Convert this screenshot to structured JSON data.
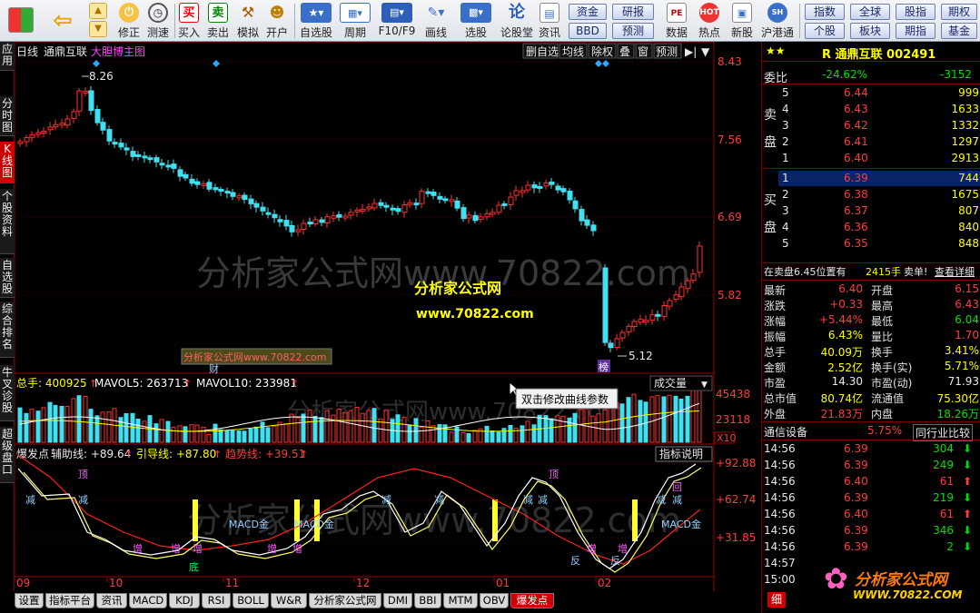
{
  "toolbar": {
    "buttons": [
      {
        "label": "修正"
      },
      {
        "label": "测速"
      },
      {
        "label": "买入"
      },
      {
        "label": "卖出"
      },
      {
        "label": "模拟"
      },
      {
        "label": "开户"
      },
      {
        "label": "自选股"
      },
      {
        "label": "周期"
      },
      {
        "label": "F10/F9"
      },
      {
        "label": "画线"
      },
      {
        "label": "选股"
      },
      {
        "label": "论股堂"
      },
      {
        "label": "资讯"
      },
      {
        "label": "数据"
      },
      {
        "label": "热点"
      },
      {
        "label": "新股"
      },
      {
        "label": "沪港通"
      }
    ],
    "buy_glyph": "买",
    "sell_glyph": "卖",
    "lun_glyph": "论",
    "nav_buttons": [
      "资金",
      "研报",
      "BBD",
      "预测",
      "指数",
      "全球",
      "股指",
      "期权",
      "个股",
      "板块",
      "期指",
      "基金"
    ]
  },
  "left_tabs": [
    "应用",
    "分时图",
    "K线图",
    "个股资料",
    "自选股",
    "综合排名",
    "牛叉诊股",
    "超级盘口"
  ],
  "main_chart": {
    "period": "日线",
    "stock_name": "通鼎互联",
    "indicator": "大胆博主图",
    "right_buttons": [
      "删自选",
      "均线",
      "除权",
      "叠",
      "窗",
      "预测"
    ],
    "price_ticks": [
      "8.43",
      "7.56",
      "6.69",
      "5.82"
    ],
    "high_label": "8.26",
    "low_label": "5.12",
    "watermark": "分析家公式网www.70822.com",
    "site_name": "分析家公式网",
    "site_url": "www.70822.com",
    "site_box": "分析家公式网www.70822.com",
    "cai_label": "财",
    "bang_label": "榜"
  },
  "volume_panel": {
    "total_label": "总手: 400925",
    "ma5_label": "MAVOL5: 263713",
    "ma10_label": "MAVOL10: 233981",
    "selector": "成交量",
    "ticks": [
      "45438",
      "23118",
      "X10"
    ],
    "tooltip": "双击修改曲线参数"
  },
  "indicator_panel": {
    "name": "爆发点",
    "aux_label": "辅助线: +89.64",
    "guide_label": "引导线: +87.80",
    "trend_label": "趋势线: +39.51",
    "help_button": "指标说明",
    "ticks": [
      "+92.88",
      "+62.74",
      "+31.85"
    ],
    "marks": [
      "顶",
      "减",
      "减",
      "增",
      "增",
      "增",
      "底",
      "MACD金",
      "MACD金",
      "增",
      "增",
      "减",
      "减",
      "减",
      "顶",
      "反",
      "增",
      "增",
      "反",
      "减",
      "减",
      "回",
      "MACD金",
      "减"
    ]
  },
  "time_axis": [
    "09",
    "10",
    "11",
    "12",
    "01",
    "02"
  ],
  "bottom_tabs": [
    "设置",
    "指标平台",
    "资讯",
    "MACD",
    "KDJ",
    "RSI",
    "BOLL",
    "W&R",
    "分析家公式网",
    "DMI",
    "BBI",
    "MTM",
    "OBV",
    "爆发点"
  ],
  "quote": {
    "stars": "★★",
    "title": "R 通鼎互联 002491",
    "weibi_label": "委比",
    "weibi": "-24.62%",
    "weicha": "-3152",
    "sell_label": "卖盘",
    "buy_label": "买盘",
    "sell": [
      {
        "n": "5",
        "p": "6.44",
        "v": "999"
      },
      {
        "n": "4",
        "p": "6.43",
        "v": "1633"
      },
      {
        "n": "3",
        "p": "6.42",
        "v": "1332"
      },
      {
        "n": "2",
        "p": "6.41",
        "v": "1297"
      },
      {
        "n": "1",
        "p": "6.40",
        "v": "2913"
      }
    ],
    "buy": [
      {
        "n": "1",
        "p": "6.39",
        "v": "744"
      },
      {
        "n": "2",
        "p": "6.38",
        "v": "1675"
      },
      {
        "n": "3",
        "p": "6.37",
        "v": "807"
      },
      {
        "n": "4",
        "p": "6.36",
        "v": "840"
      },
      {
        "n": "5",
        "p": "6.35",
        "v": "848"
      }
    ],
    "note_left": "在卖盘6.45位置有",
    "note_vol": "2415手",
    "note_right": "卖单!",
    "note_link": "查看详细",
    "stats": [
      {
        "l1": "最新",
        "v1": "6.40",
        "l2": "开盘",
        "v2": "6.15",
        "c1": "red",
        "c2": "red"
      },
      {
        "l1": "涨跌",
        "v1": "+0.33",
        "l2": "最高",
        "v2": "6.43",
        "c1": "red",
        "c2": "red"
      },
      {
        "l1": "涨幅",
        "v1": "+5.44%",
        "l2": "最低",
        "v2": "6.04",
        "c1": "red",
        "c2": "grn"
      },
      {
        "l1": "振幅",
        "v1": "6.43%",
        "l2": "量比",
        "v2": "1.70",
        "c1": "yel",
        "c2": "red"
      },
      {
        "l1": "总手",
        "v1": "40.09万",
        "l2": "换手",
        "v2": "3.41%",
        "c1": "yel",
        "c2": "yel"
      },
      {
        "l1": "金额",
        "v1": "2.52亿",
        "l2": "换手(实)",
        "v2": "5.71%",
        "c1": "yel",
        "c2": "yel"
      },
      {
        "l1": "市盈",
        "v1": "14.30",
        "l2": "市盈(动)",
        "v2": "71.93",
        "c1": "wht",
        "c2": "wht"
      },
      {
        "l1": "总市值",
        "v1": "80.74亿",
        "l2": "流通值",
        "v2": "75.30亿",
        "c1": "yel",
        "c2": "yel"
      },
      {
        "l1": "外盘",
        "v1": "21.83万",
        "l2": "内盘",
        "v2": "18.26万",
        "c1": "red",
        "c2": "grn"
      }
    ],
    "industry": "通信设备",
    "industry_pct": "5.75%",
    "industry_btn": "同行业比较",
    "ticks": [
      {
        "t": "14:56",
        "p": "6.39",
        "v": "304",
        "d": "dn"
      },
      {
        "t": "14:56",
        "p": "6.39",
        "v": "249",
        "d": "dn"
      },
      {
        "t": "14:56",
        "p": "6.40",
        "v": "61",
        "d": "up"
      },
      {
        "t": "14:56",
        "p": "6.39",
        "v": "219",
        "d": "dn"
      },
      {
        "t": "14:56",
        "p": "6.40",
        "v": "61",
        "d": "up"
      },
      {
        "t": "14:56",
        "p": "6.39",
        "v": "346",
        "d": "dn"
      },
      {
        "t": "14:56",
        "p": "6.39",
        "v": "2",
        "d": "dn"
      },
      {
        "t": "14:57",
        "p": "",
        "v": "",
        "d": ""
      },
      {
        "t": "15:00",
        "p": "",
        "v": "",
        "d": ""
      }
    ],
    "logo_text": "分析家公式网",
    "logo_url": "WWW.70822.COM",
    "bottom_tab": "细"
  }
}
